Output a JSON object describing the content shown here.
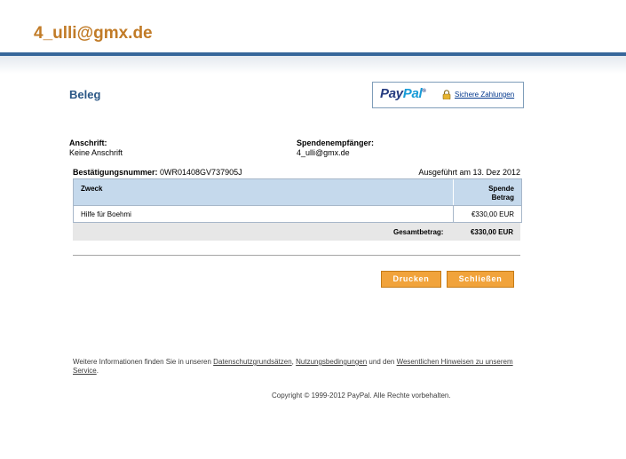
{
  "header": {
    "user_email": "4_ulli@gmx.de"
  },
  "colors": {
    "brand": "#c17b27",
    "topbar": "#36679a",
    "title": "#2b5786",
    "button": "#f1a33b",
    "table_header": "#c5d9ec"
  },
  "page": {
    "title": "Beleg"
  },
  "paypal": {
    "logo_pay": "Pay",
    "logo_pal": "Pal",
    "logo_tm": "®",
    "secure_link": "Sichere Zahlungen",
    "icon": "lock-icon"
  },
  "sender": {
    "label": "Anschrift:",
    "value": "Keine Anschrift"
  },
  "recipient": {
    "label": "Spendenempfänger:",
    "value": "4_ulli@gmx.de"
  },
  "confirmation": {
    "label": "Bestätigungsnummer:",
    "number": "0WR01408GV737905J",
    "executed": "Ausgeführt am 13. Dez 2012"
  },
  "table": {
    "col_purpose": "Zweck",
    "col_amount_line1": "Spende",
    "col_amount_line2": "Betrag",
    "rows": [
      {
        "purpose": "Hilfe für Boehmi",
        "amount": "€330,00 EUR"
      }
    ],
    "total_label": "Gesamtbetrag:",
    "total_value": "€330,00 EUR"
  },
  "buttons": {
    "print": "Drucken",
    "close": "Schließen"
  },
  "footer": {
    "text_before": "Weitere Informationen finden Sie in unseren ",
    "link_privacy": "Datenschutzgrundsätzen",
    "sep1": ", ",
    "link_terms": "Nutzungsbedingungen",
    "text_and": " und den ",
    "link_notes": "Wesentlichen Hinweisen zu unserem Service",
    "text_end": ".",
    "copyright": "Copyright © 1999-2012 PayPal. Alle Rechte vorbehalten."
  }
}
